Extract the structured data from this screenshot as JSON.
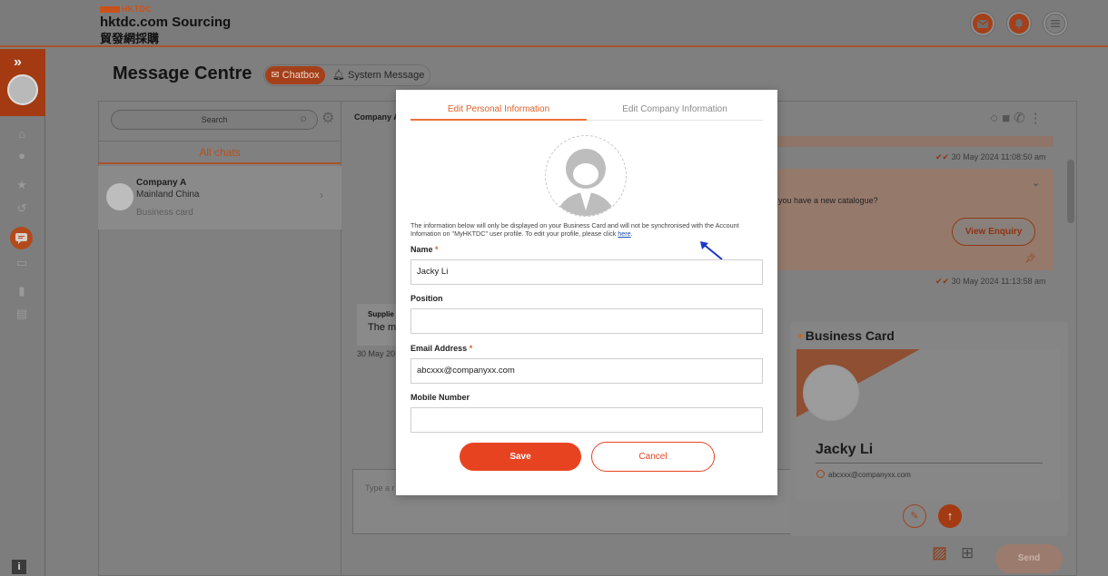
{
  "header": {
    "brand_mark": "HKTDC",
    "brand_title": "hktdc.com Sourcing",
    "brand_cn": "貿發網採購",
    "icons": [
      "mail-icon",
      "bell-icon",
      "menu-icon"
    ]
  },
  "sidebar": {
    "expand_label": "»",
    "items": [
      "home-icon",
      "user-icon",
      "star-icon",
      "history-icon",
      "chat-icon",
      "card-icon",
      "bookmark-icon",
      "document-icon"
    ],
    "info_label": "i"
  },
  "page": {
    "title": "Message Centre",
    "tab_chatbox": "Chatbox",
    "tab_system": "System Message"
  },
  "chat_list": {
    "search_placeholder": "Search",
    "section_label": "All chats",
    "conversation": {
      "name": "Company A",
      "region": "Mainland China",
      "preview": "Business card"
    }
  },
  "conversation": {
    "header_name": "Company A",
    "timestamp_1": "30 May 2024 11:08:50 am",
    "enquiry_text": "you have a new catalogue?",
    "view_enquiry_label": "View Enquiry",
    "timestamp_2": "30 May 2024 11:13:58 am",
    "supplier_label": "Supplie",
    "supplier_text": "The m",
    "supplier_date": "30 May 20",
    "compose_placeholder": "Type a r",
    "send_label": "Send"
  },
  "business_card": {
    "title": "Business Card",
    "name": "Jacky Li",
    "email": "abcxxx@companyxx.com"
  },
  "modal": {
    "tab_personal": "Edit Personal Information",
    "tab_company": "Edit Company Information",
    "notice": "The information below will only be displayed on your Business Card and will not be synchronised with the Account Infomation on \"MyHKTDC\" user profile. To edit your profile, please click ",
    "notice_link": "here",
    "notice_end": ".",
    "fields": {
      "name_label": "Name",
      "name_value": "Jacky Li",
      "position_label": "Position",
      "position_value": "",
      "email_label": "Email Address",
      "email_value": "abcxxx@companyxx.com",
      "mobile_label": "Mobile Number",
      "mobile_value": ""
    },
    "required_mark": "*",
    "save_label": "Save",
    "cancel_label": "Cancel"
  },
  "colors": {
    "accent": "#e84321",
    "tab_active": "#e0622a",
    "link": "#1b4fb8",
    "overlay": "#7f7f7f"
  }
}
